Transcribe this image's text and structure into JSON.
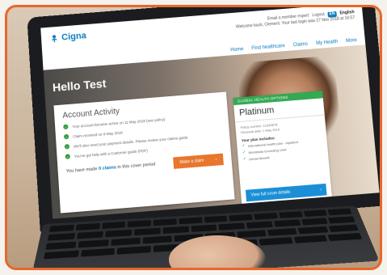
{
  "brand": {
    "name": "Cigna",
    "color": "#0a7bbf"
  },
  "header": {
    "links": [
      "Email a member expert",
      "Logout"
    ],
    "lang_code": "EN",
    "lang_label": "English",
    "welcome": "Welcome back, Clement. Your last login was 27 Nov 2018 at 16:57"
  },
  "nav": [
    "Home",
    "Find healthcare",
    "Claims",
    "My Health",
    "More"
  ],
  "hero": {
    "greeting": "Hello Test"
  },
  "activity": {
    "title": "Account Activity",
    "items": [
      "Your account became active on 11 May 2018 (see policy)",
      "Claim received on 9 May 2018",
      "We'll also need your payment details. Please review your claims guide.",
      "You've got help with a Customer guide (PDF)"
    ],
    "claims_prefix": "You have made",
    "claims_count": "0 claims",
    "claims_suffix": "in this cover period",
    "claim_button": "Make a claim"
  },
  "plan": {
    "tag": "GLOBAL HEALTH OPTIONS",
    "name": "Platinum",
    "meta_lines": [
      "Policy number: 12345678",
      "Renewal date: 1 May 2019"
    ],
    "benefits_title": "Your plan includes:",
    "benefits": [
      "International health plan - Inpatient",
      "Worldwide Excluding USA",
      "Dental Benefit"
    ],
    "button": "View full cover details"
  },
  "colors": {
    "accent_orange": "#e8762c",
    "check_green": "#2f9a3d",
    "frame": "#e8672a",
    "cta_blue": "#1a8fd6"
  }
}
